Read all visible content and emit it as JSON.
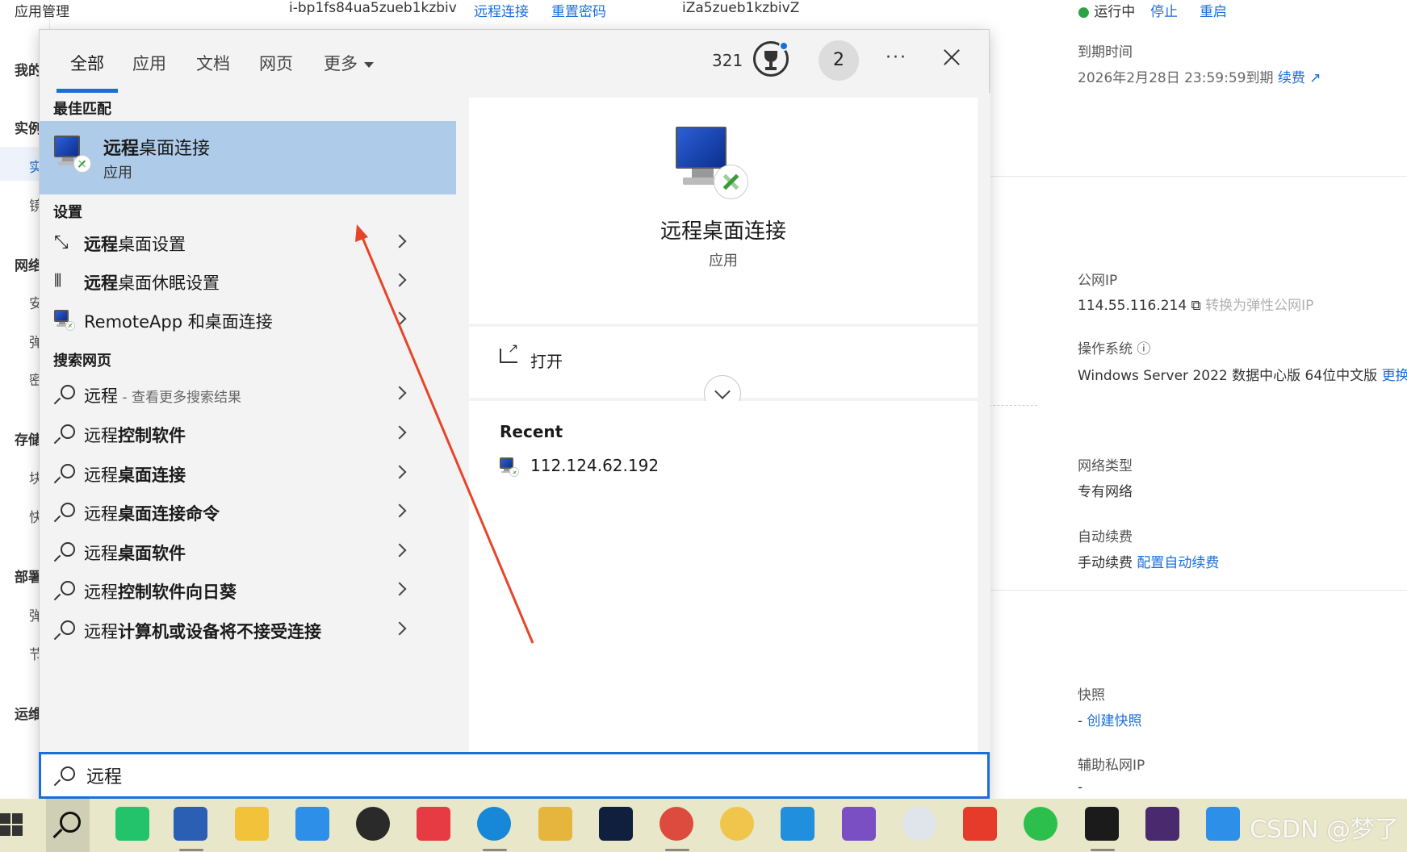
{
  "background": {
    "sidebar": {
      "app_mgmt": "应用管理",
      "items": [
        "我的",
        "实例",
        "实",
        "镜",
        "网络",
        "安",
        "弹",
        "密",
        "存储",
        "块",
        "快",
        "部署",
        "弹",
        "节",
        "运维"
      ]
    },
    "top_bar": {
      "instance_id": "i-bp1fs84ua5zueb1kzbiv",
      "remote_link": "远程连接",
      "reset_pwd": "重置密码",
      "hostname": "iZa5zueb1kzbivZ",
      "status": "运行中",
      "stop": "停止",
      "restart": "重启"
    },
    "details": {
      "expire_label": "到期时间",
      "expire_value": "2026年2月28日 23:59:59到期",
      "renew": "续费",
      "public_ip_label": "公网IP",
      "public_ip_value": "114.55.116.214",
      "convert_eip": "转换为弹性公网IP",
      "os_label": "操作系统",
      "os_value": "Windows Server 2022 数据中心版 64位中文版",
      "os_change": "更换",
      "net_type_label": "网络类型",
      "net_type_value": "专有网络",
      "auto_renew_label": "自动续费",
      "auto_renew_value": "手动续费",
      "auto_renew_config": "配置自动续费",
      "snapshot_label": "快照",
      "snapshot_dash": "-",
      "snapshot_create": "创建快照",
      "secondary_ip_label": "辅助私网IP",
      "secondary_ip_value": "-"
    }
  },
  "search_panel": {
    "tabs": [
      {
        "label": "全部",
        "active": true
      },
      {
        "label": "应用",
        "active": false
      },
      {
        "label": "文档",
        "active": false
      },
      {
        "label": "网页",
        "active": false
      },
      {
        "label": "更多",
        "active": false
      }
    ],
    "points": "321",
    "avatar_text": "2",
    "more_options": "···",
    "best_match_header": "最佳匹配",
    "best_match": {
      "title_bold": "远程",
      "title_rest": "桌面连接",
      "subtitle": "应用"
    },
    "settings_header": "设置",
    "settings": [
      {
        "bold": "远程",
        "rest": "桌面设置",
        "icon": "remote-desktop-settings-icon"
      },
      {
        "bold": "远程",
        "rest": "桌面休眠设置",
        "icon": "power-sleep-icon"
      },
      {
        "bold": "",
        "rest": "RemoteApp 和桌面连接",
        "icon": "remoteapp-icon"
      }
    ],
    "web_header": "搜索网页",
    "web_results": [
      {
        "plain": "远程",
        "bold": "",
        "hint": " - 查看更多搜索结果"
      },
      {
        "plain": "远程",
        "bold": "控制软件",
        "hint": ""
      },
      {
        "plain": "远程",
        "bold": "桌面连接",
        "hint": ""
      },
      {
        "plain": "远程",
        "bold": "桌面连接命令",
        "hint": ""
      },
      {
        "plain": "远程",
        "bold": "桌面软件",
        "hint": ""
      },
      {
        "plain": "远程",
        "bold": "控制软件向日葵",
        "hint": ""
      },
      {
        "plain": "远程",
        "bold": "计算机或设备将不接受连接",
        "hint": ""
      }
    ],
    "preview": {
      "app_name": "远程桌面连接",
      "app_type": "应用",
      "open_label": "打开",
      "recent_title": "Recent",
      "recent_items": [
        "112.124.62.192"
      ]
    },
    "search_query": "远程"
  },
  "taskbar": {
    "apps": [
      "start-icon",
      "search-icon",
      "messenger-icon",
      "word-icon",
      "file-explorer-icon",
      "feishu-icon",
      "qq-icon",
      "netease-music-icon",
      "edge-icon",
      "xmind-icon",
      "photoshop-icon",
      "chrome-icon",
      "sunflower-icon",
      "vscode-icon",
      "visual-studio-icon",
      "wechat-devtools-icon",
      "wps-icon",
      "wechat-icon",
      "terminal-icon",
      "vs-terminal-icon",
      "feishu2-icon"
    ]
  },
  "watermark": "CSDN @梦了",
  "colors": {
    "accent": "#1a6ddb",
    "best_match_bg": "#aecbea",
    "arrow": "#e8442a",
    "taskbar": "#e8e7c9"
  }
}
